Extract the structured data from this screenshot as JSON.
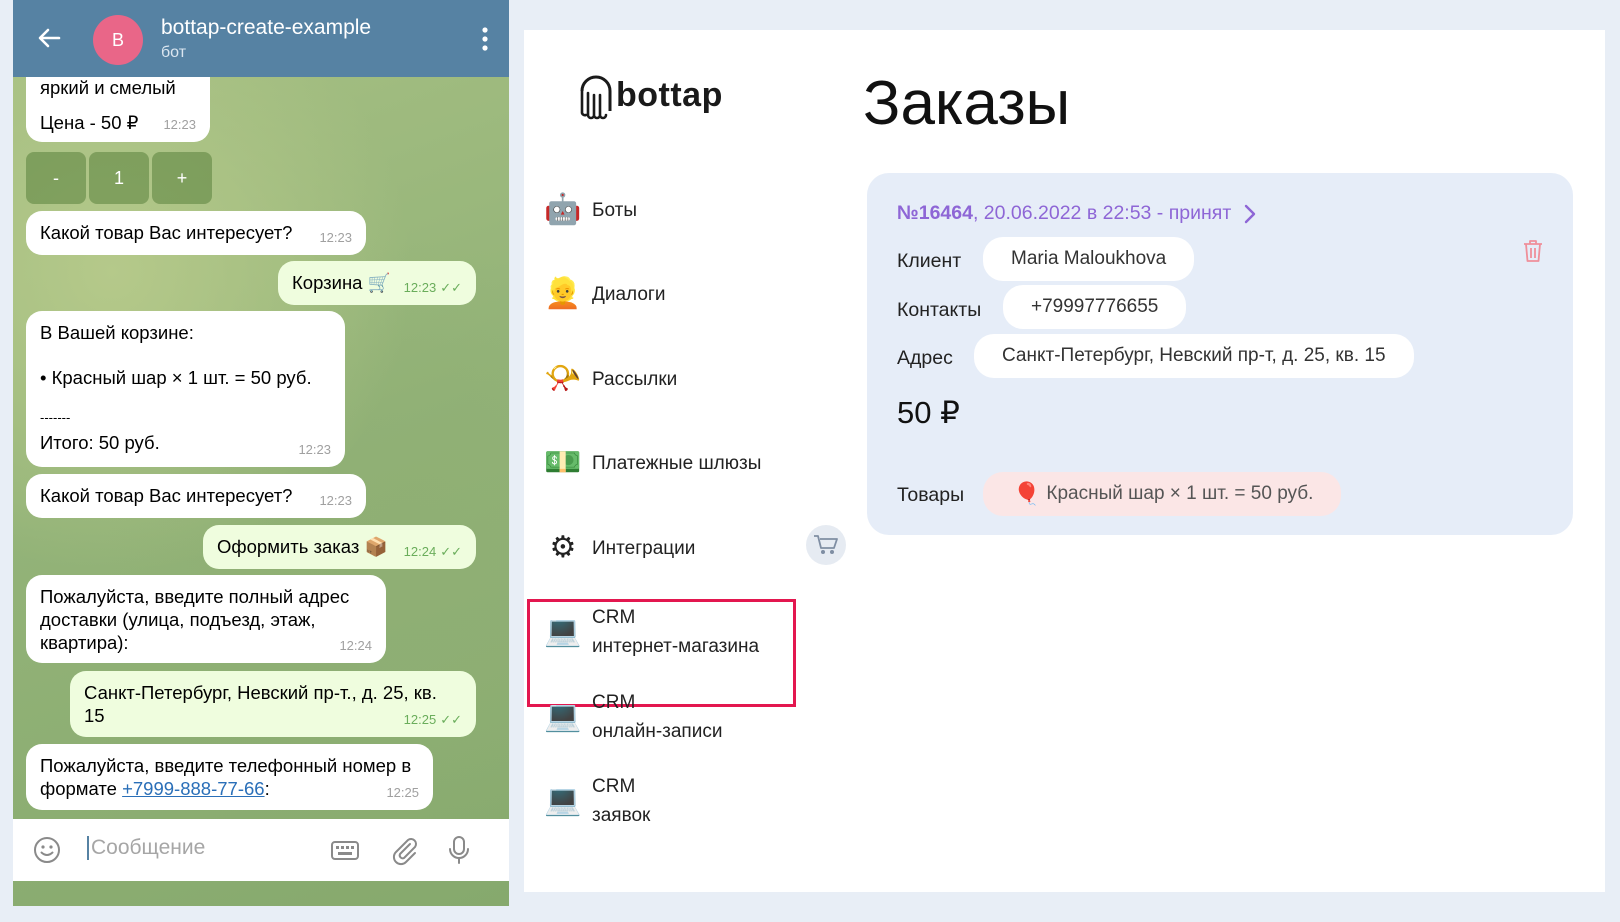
{
  "telegram": {
    "chat_title": "bottap-create-example",
    "chat_subtitle": "бот",
    "avatar_letter": "B",
    "colors": {
      "header": "#5682a3",
      "avatar": "#e96688",
      "outgoing": "#effdde",
      "link": "#2a6fb8"
    },
    "messages": {
      "product_partial_line": "яркий и смелый",
      "product_price": "Цена - 50 ₽",
      "product_time": "12:23",
      "keyboard": {
        "minus": "-",
        "qty": "1",
        "plus": "+"
      },
      "q1_text": "Какой товар Вас интересует?",
      "q1_time": "12:23",
      "cart_text": "Корзина 🛒",
      "cart_time": "12:23",
      "cart_content_l1": "В Вашей корзине:",
      "cart_content_l2": "• Красный шар × 1 шт. = 50 руб.",
      "cart_content_l3": "-------",
      "cart_content_l4": "Итого: 50 руб.",
      "cart_content_time": "12:23",
      "q2_text": "Какой товар Вас интересует?",
      "q2_time": "12:23",
      "checkout_text": "Оформить заказ 📦",
      "checkout_time": "12:24",
      "address_prompt": "Пожалуйста, введите полный адрес доставки (улица, подъезд, этаж, квартира):",
      "address_prompt_time": "12:24",
      "address_answer": "Санкт-Петербург, Невский пр-т., д. 25, кв. 15",
      "address_answer_time": "12:25",
      "phone_prompt_before": "Пожалуйста, введите телефонный номер в формате ",
      "phone_prompt_link": "+7999-888-77-66",
      "phone_prompt_after": ":",
      "phone_prompt_time": "12:25"
    },
    "input_placeholder": "Сообщение"
  },
  "admin": {
    "logo_text": "bottap",
    "page_title": "Заказы",
    "nav": [
      {
        "icon": "robot",
        "label": "Боты"
      },
      {
        "icon": "person",
        "label": "Диалоги"
      },
      {
        "icon": "horn",
        "label": "Рассылки"
      },
      {
        "icon": "money",
        "label": "Платежные шлюзы"
      },
      {
        "icon": "gear",
        "label": "Интеграции"
      },
      {
        "icon": "laptop",
        "label_l1": "CRM",
        "label_l2": "интернет-магазина"
      },
      {
        "icon": "laptop",
        "label_l1": "CRM",
        "label_l2": "онлайн-записи"
      },
      {
        "icon": "laptop",
        "label_l1": "CRM",
        "label_l2": "заявок"
      }
    ],
    "highlight_color": "#e3174f",
    "order": {
      "number": "№16464",
      "details": ", 20.06.2022 в 22:53 - принят",
      "client_label": "Клиент",
      "client_value": "Maria Maloukhova",
      "contacts_label": "Контакты",
      "contacts_value": "+79997776655",
      "address_label": "Адрес",
      "address_value": "Санкт-Петербург, Невский пр-т, д. 25, кв. 15",
      "price": "50 ₽",
      "goods_label": "Товары",
      "goods_value": "Красный шар × 1 шт. = 50 руб.",
      "accent_color": "#8e66d6",
      "card_color": "#e6edf8"
    }
  }
}
